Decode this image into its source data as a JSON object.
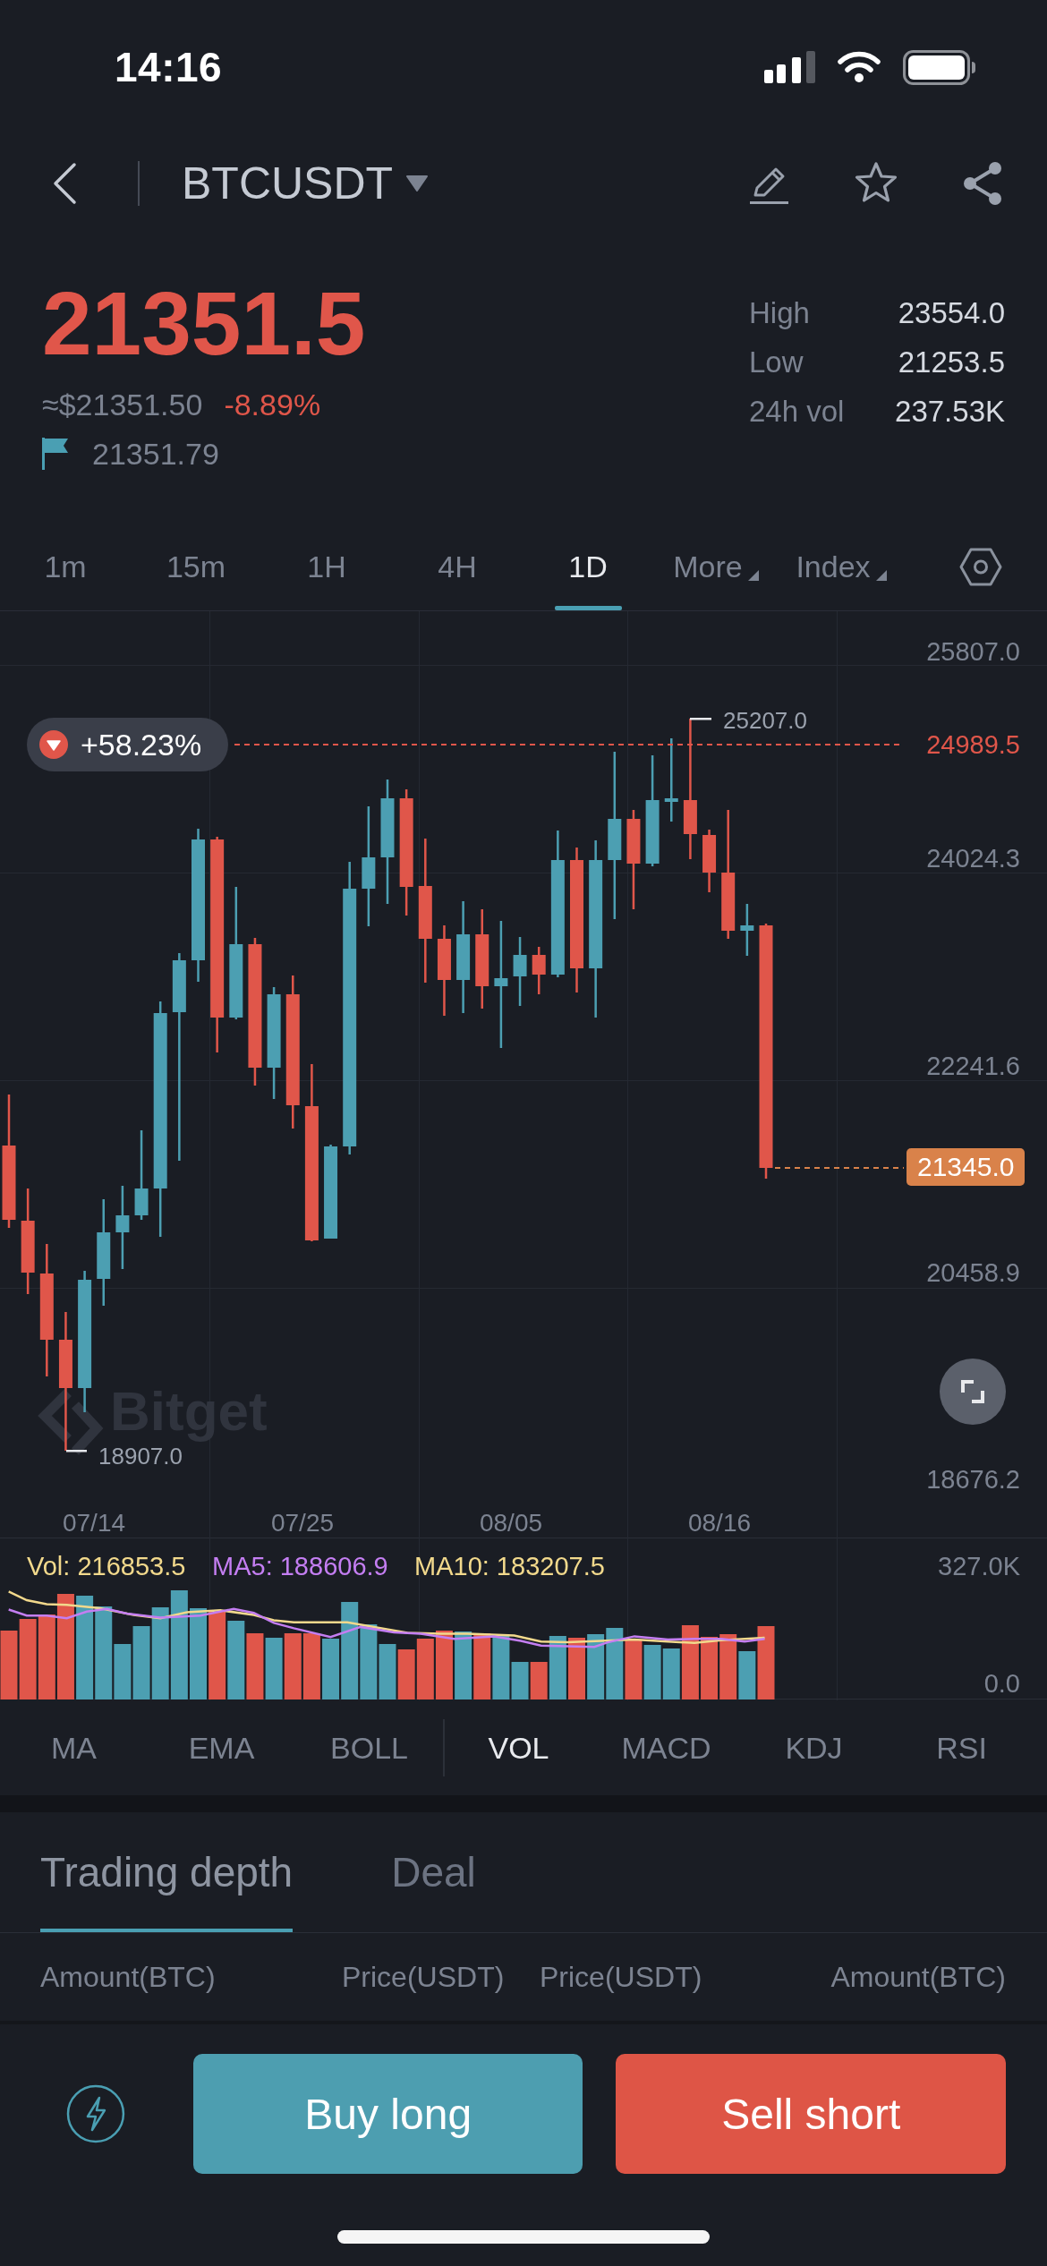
{
  "status_bar": {
    "time": "14:16"
  },
  "header": {
    "symbol": "BTCUSDT"
  },
  "ticker": {
    "falling": true,
    "last_price": "21351.5",
    "usd_value": "≈$21351.50",
    "change": "-8.89%",
    "mark_price": "21351.79",
    "stats": [
      {
        "label": "High",
        "value": "23554.0"
      },
      {
        "label": "Low",
        "value": "21253.5"
      },
      {
        "label": "24h vol",
        "value": "237.53K"
      }
    ]
  },
  "timeframes": [
    {
      "label": "1m",
      "kind": "interval",
      "selected": false
    },
    {
      "label": "15m",
      "kind": "interval",
      "selected": false
    },
    {
      "label": "1H",
      "kind": "interval",
      "selected": false
    },
    {
      "label": "4H",
      "kind": "interval",
      "selected": false
    },
    {
      "label": "1D",
      "kind": "interval",
      "selected": true
    },
    {
      "label": "More",
      "kind": "dropdown",
      "selected": false
    },
    {
      "label": "Index",
      "kind": "dropdown",
      "selected": false
    }
  ],
  "chart": {
    "price_ticks": [
      "25807.0",
      "24024.3",
      "22241.6",
      "20458.9",
      "18676.2"
    ],
    "date_ticks": [
      "07/14",
      "07/25",
      "08/05",
      "08/16"
    ],
    "watermark": "Bitget",
    "period_high": "25207.0",
    "period_low": "18907.0",
    "range_change": "+58.23%",
    "guide_price": "24989.5",
    "last_price": "21345.0"
  },
  "volume": {
    "readings": [
      {
        "text": "Vol: 216853.5",
        "color": "#f2d98c"
      },
      {
        "text": "MA5: 188606.9",
        "color": "#c47ef2"
      },
      {
        "text": "MA10: 183207.5",
        "color": "#f2d98c"
      }
    ],
    "max_tick": "327.0K",
    "min_tick": "0.0"
  },
  "indicators": {
    "main": [
      {
        "label": "MA",
        "selected": false
      },
      {
        "label": "EMA",
        "selected": false
      },
      {
        "label": "BOLL",
        "selected": false
      }
    ],
    "sub": [
      {
        "label": "VOL",
        "selected": true
      },
      {
        "label": "MACD",
        "selected": false
      },
      {
        "label": "KDJ",
        "selected": false
      },
      {
        "label": "RSI",
        "selected": false
      }
    ]
  },
  "depth": {
    "tabs": [
      {
        "label": "Trading depth",
        "selected": true
      },
      {
        "label": "Deal",
        "selected": false
      }
    ],
    "columns": [
      "Amount(BTC)",
      "Price(USDT)",
      "Price(USDT)",
      "Amount(BTC)"
    ]
  },
  "actions": [
    {
      "label": "Buy long",
      "kind": "buy"
    },
    {
      "label": "Sell short",
      "kind": "sell"
    }
  ]
}
